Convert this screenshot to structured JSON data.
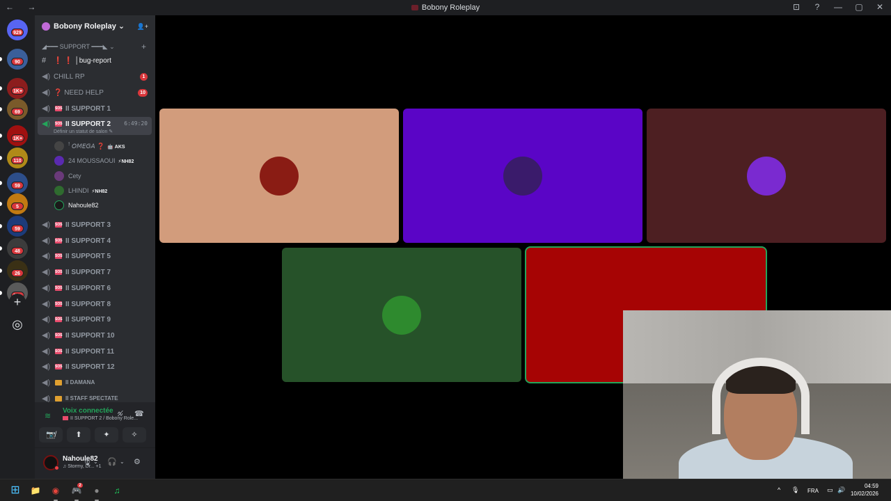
{
  "window": {
    "title": "Bobony Roleplay",
    "nav_icons": "← →",
    "controls": [
      "⊡",
      "?",
      "—",
      "▢",
      "✕"
    ]
  },
  "guilds": {
    "home_badge": "929",
    "items": [
      {
        "badge": "90",
        "color": "#3b5f9a"
      },
      {
        "badge": "1K+",
        "color": "#8c1d1d"
      },
      {
        "badge": "69",
        "color": "#7a5a2a"
      },
      {
        "badge": "1K+",
        "color": "#a01010"
      },
      {
        "badge": "110",
        "color": "#b08a18"
      },
      {
        "badge": "59",
        "color": "#2d4e8a"
      },
      {
        "badge": "5",
        "color": "#c27a12"
      },
      {
        "badge": "59",
        "color": "#1c3b7a"
      },
      {
        "badge": "48",
        "color": "#3c3c3c"
      },
      {
        "badge": "26",
        "color": "#3a3015"
      },
      {
        "badge": "2K+",
        "color": "#5a5a5a"
      }
    ],
    "add_label": "+",
    "discover_label": "◎"
  },
  "server": {
    "name": "Bobony Roleplay",
    "chevron": "⌄",
    "invite_icon": "👤+"
  },
  "category": {
    "label": "◢━━━ SUPPORT ━━━◣",
    "chevron": "⌄",
    "plus": "+"
  },
  "channels": [
    {
      "type": "text",
      "label": "❗ ❗ │bug-report",
      "badge": ""
    },
    {
      "type": "voice",
      "label": "CHILL RP",
      "badge": "1"
    },
    {
      "type": "voice",
      "label": "❓ NEED HELP",
      "badge": "10"
    },
    {
      "type": "voice",
      "label": "II SUPPORT 1",
      "badge": ""
    }
  ],
  "active_channel": {
    "label": "II SUPPORT 2",
    "timer": "6:49:20",
    "status": "Définir un statut de salon ✎"
  },
  "voice_users": [
    {
      "name": "ꜝ 𝘖𝘔𝘌𝘎𝘈 ❓",
      "tag": "🤖 AKS",
      "color": "#444"
    },
    {
      "name": "24 MOUSSAOUI",
      "tag": "⚡NH82",
      "color": "#5a2ab0"
    },
    {
      "name": "Cety",
      "tag": "",
      "color": "#6a3a7a"
    },
    {
      "name": "LHINDI",
      "tag": "⚡NH82",
      "color": "#2f6b2f"
    },
    {
      "name": "Nahoule82",
      "tag": "",
      "color": "#1a1a1a"
    }
  ],
  "channels_after": [
    {
      "label": "II SUPPORT 3",
      "icon": "SOS"
    },
    {
      "label": "II SUPPORT 4",
      "icon": "SOS"
    },
    {
      "label": "II SUPPORT 5",
      "icon": "SOS"
    },
    {
      "label": "II SUPPORT 7",
      "icon": "SOS"
    },
    {
      "label": "II SUPPORT 6",
      "icon": "SOS"
    },
    {
      "label": "II SUPPORT 8",
      "icon": "SOS"
    },
    {
      "label": "II SUPPORT 9",
      "icon": "SOS"
    },
    {
      "label": "II SUPPORT 10",
      "icon": "SOS"
    },
    {
      "label": "II SUPPORT 11",
      "icon": "SOS"
    },
    {
      "label": "II SUPPORT 12",
      "icon": "SOS"
    },
    {
      "label": "II DAMANA",
      "icon": "lock"
    },
    {
      "label": "II STAFF SPECTATE",
      "icon": "lock"
    }
  ],
  "voice_panel": {
    "title": "Voix connectée",
    "subtitle": "II SUPPORT 2 / Bobony Role...",
    "buttons": [
      "📷̸",
      "⬆",
      "✦",
      "✧"
    ]
  },
  "user": {
    "name": "Nahoule82",
    "status": "♫ Stormy, Dr...  +1"
  },
  "stage": {
    "tiles": [
      {
        "bg": "#d29c7c",
        "avatar": "#8a1c14",
        "speaking": false
      },
      {
        "bg": "#5a05c6",
        "avatar": "#3a1b6b",
        "speaking": false
      },
      {
        "bg": "#4d1f22",
        "avatar": "#7a2ad0",
        "speaking": false
      },
      {
        "bg": "#265229",
        "avatar": "#2e8a2e",
        "speaking": false
      },
      {
        "bg": "#a60404",
        "avatar": "",
        "speaking": true
      }
    ]
  },
  "taskbar": {
    "apps": [
      "⊞",
      "📁",
      "◉",
      "🎮",
      "●",
      "♫"
    ],
    "tray": {
      "chevron": "^",
      "mic": "🎙",
      "lang": "FRA",
      "net": "▭",
      "vol": "🔊"
    },
    "time": "04:59",
    "date": "10/02/2026",
    "discord_badge": "2"
  }
}
